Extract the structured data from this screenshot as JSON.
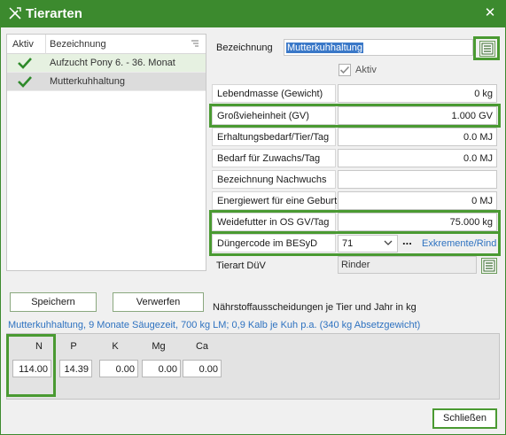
{
  "window": {
    "title": "Tierarten"
  },
  "list": {
    "col_aktiv": "Aktiv",
    "col_bezeichnung": "Bezeichnung",
    "rows": [
      {
        "active": true,
        "label": "Aufzucht Pony 6. - 36. Monat"
      },
      {
        "active": true,
        "label": "Mutterkuhhaltung"
      }
    ]
  },
  "buttons": {
    "save": "Speichern",
    "discard": "Verwerfen",
    "close": "Schließen"
  },
  "form": {
    "bezeichnung_label": "Bezeichnung",
    "bezeichnung_value": "Mutterkuhhaltung",
    "aktiv_label": "Aktiv",
    "lebendmasse_label": "Lebendmasse (Gewicht)",
    "lebendmasse_value": "0 kg",
    "gv_label": "Großvieheinheit (GV)",
    "gv_value": "1.000 GV",
    "erhaltung_label": "Erhaltungsbedarf/Tier/Tag",
    "erhaltung_value": "0.0 MJ",
    "zuwachs_label": "Bedarf für Zuwachs/Tag",
    "zuwachs_value": "0.0 MJ",
    "nachwuchs_label": "Bezeichnung Nachwuchs",
    "nachwuchs_value": "",
    "energiewert_label": "Energiewert für eine Geburt",
    "energiewert_value": "0 MJ",
    "weidefutter_label": "Weidefutter in OS GV/Tag",
    "weidefutter_value": "75.000 kg",
    "duenger_label": "Düngercode im BESyD",
    "duenger_value": "71",
    "duenger_dots": "...",
    "duenger_link": "Exkremente/Rind",
    "tierart_label": "Tierart DüV",
    "tierart_value": "Rinder"
  },
  "nutrients": {
    "title": "Nährstoffausscheidungen je Tier und Jahr in kg",
    "summary": "Mutterkuhhaltung, 9 Monate Säugezeit, 700 kg LM; 0,9 Kalb je Kuh p.a. (340 kg Absetzgewicht)",
    "items": [
      {
        "label": "N",
        "value": "114.00"
      },
      {
        "label": "P",
        "value": "14.39"
      },
      {
        "label": "K",
        "value": "0.00"
      },
      {
        "label": "Mg",
        "value": "0.00"
      },
      {
        "label": "Ca",
        "value": "0.00"
      }
    ]
  },
  "colors": {
    "accent": "#3c8a2e",
    "highlight": "#4a9a32",
    "link": "#2e72c0",
    "selection": "#3a78c8"
  }
}
